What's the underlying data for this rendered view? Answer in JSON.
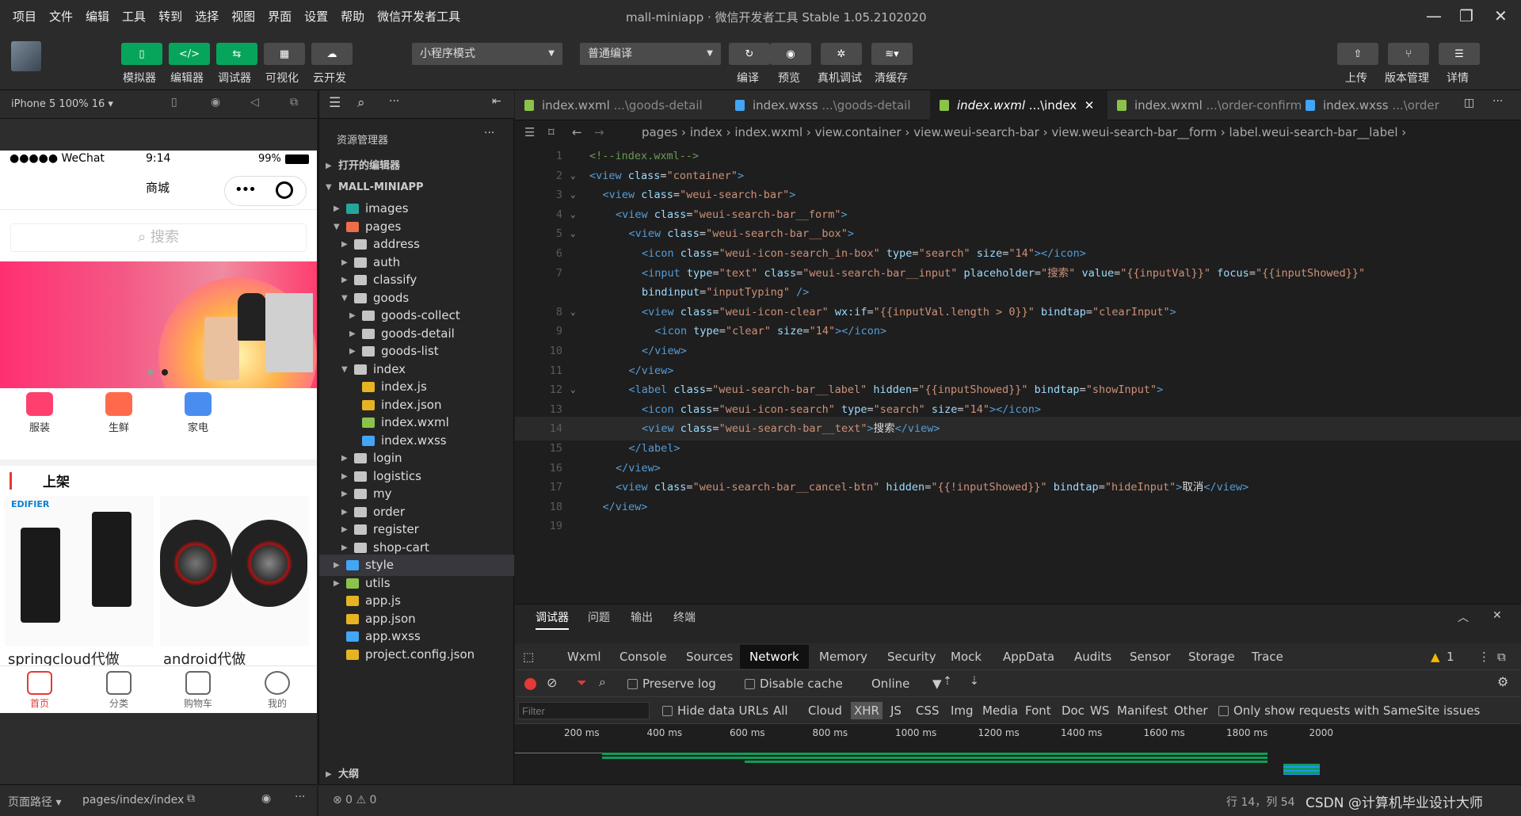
{
  "menu": [
    "项目",
    "文件",
    "编辑",
    "工具",
    "转到",
    "选择",
    "视图",
    "界面",
    "设置",
    "帮助",
    "微信开发者工具"
  ],
  "window_title": "mall-miniapp · 微信开发者工具 Stable 1.05.2102020",
  "toolbar": {
    "left_labels": [
      "模拟器",
      "编辑器",
      "调试器",
      "可视化",
      "云开发"
    ],
    "mode_dropdown": "小程序模式",
    "compile_dropdown": "普通编译",
    "mid_labels": [
      "编译",
      "预览",
      "真机调试",
      "清缓存"
    ],
    "right_labels": [
      "上传",
      "版本管理",
      "详情"
    ]
  },
  "simulator": {
    "device": "iPhone 5 100% 16 ▾",
    "carrier": "●●●●● WeChat",
    "time": "9:14",
    "battery": "99%",
    "nav_title": "商城",
    "search_placeholder": "搜索",
    "categories": [
      "服装",
      "生鲜",
      "家电"
    ],
    "section_title": "上架",
    "products": [
      "springcloud代做",
      "android代做"
    ],
    "brand1": "EDIFIER",
    "tabs": [
      "首页",
      "分类",
      "购物车",
      "我的"
    ],
    "footer_path_label": "页面路径 ▾",
    "footer_path": "pages/index/index"
  },
  "explorer": {
    "title": "资源管理器",
    "open_editors": "打开的编辑器",
    "root": "MALL-MINIAPP",
    "items": [
      {
        "name": "images",
        "depth": 1,
        "open": false,
        "kind": "folder-img"
      },
      {
        "name": "pages",
        "depth": 1,
        "open": true,
        "kind": "folder-pages"
      },
      {
        "name": "address",
        "depth": 2,
        "open": false,
        "kind": "folder"
      },
      {
        "name": "auth",
        "depth": 2,
        "open": false,
        "kind": "folder"
      },
      {
        "name": "classify",
        "depth": 2,
        "open": false,
        "kind": "folder"
      },
      {
        "name": "goods",
        "depth": 2,
        "open": true,
        "kind": "folder"
      },
      {
        "name": "goods-collect",
        "depth": 3,
        "open": false,
        "kind": "folder"
      },
      {
        "name": "goods-detail",
        "depth": 3,
        "open": false,
        "kind": "folder"
      },
      {
        "name": "goods-list",
        "depth": 3,
        "open": false,
        "kind": "folder"
      },
      {
        "name": "index",
        "depth": 2,
        "open": true,
        "kind": "folder"
      },
      {
        "name": "index.js",
        "depth": 3,
        "kind": "js"
      },
      {
        "name": "index.json",
        "depth": 3,
        "kind": "json"
      },
      {
        "name": "index.wxml",
        "depth": 3,
        "kind": "wxml"
      },
      {
        "name": "index.wxss",
        "depth": 3,
        "kind": "wxss"
      },
      {
        "name": "login",
        "depth": 2,
        "open": false,
        "kind": "folder"
      },
      {
        "name": "logistics",
        "depth": 2,
        "open": false,
        "kind": "folder"
      },
      {
        "name": "my",
        "depth": 2,
        "open": false,
        "kind": "folder"
      },
      {
        "name": "order",
        "depth": 2,
        "open": false,
        "kind": "folder"
      },
      {
        "name": "register",
        "depth": 2,
        "open": false,
        "kind": "folder"
      },
      {
        "name": "shop-cart",
        "depth": 2,
        "open": false,
        "kind": "folder"
      },
      {
        "name": "style",
        "depth": 1,
        "open": false,
        "kind": "folder-style",
        "selected": true
      },
      {
        "name": "utils",
        "depth": 1,
        "open": false,
        "kind": "folder-utils"
      },
      {
        "name": "app.js",
        "depth": 1,
        "kind": "js"
      },
      {
        "name": "app.json",
        "depth": 1,
        "kind": "json"
      },
      {
        "name": "app.wxss",
        "depth": 1,
        "kind": "wxss"
      },
      {
        "name": "project.config.json",
        "depth": 1,
        "kind": "json"
      }
    ],
    "outline": "大纲"
  },
  "editor": {
    "tabs": [
      {
        "name": "index.wxml",
        "path": "...\\goods-detail",
        "kind": "wxml"
      },
      {
        "name": "index.wxss",
        "path": "...\\goods-detail",
        "kind": "wxss"
      },
      {
        "name": "index.wxml",
        "path": "...\\index",
        "kind": "wxml",
        "active": true
      },
      {
        "name": "index.wxml",
        "path": "...\\order-confirm",
        "kind": "wxml"
      },
      {
        "name": "index.wxss",
        "path": "...\\order",
        "kind": "wxss"
      }
    ],
    "breadcrumb": "pages › index › index.wxml › view.container › view.weui-search-bar › view.weui-search-bar__form › label.weui-search-bar__label ›",
    "lines": [
      {
        "n": "1",
        "indent": 0,
        "html": "<span class=\"cm\">&lt;!--index.wxml--&gt;</span>"
      },
      {
        "n": "2",
        "indent": 0,
        "fold": true,
        "html": "<span class=\"tg\">&lt;view</span> <span class=\"at\">class</span>=<span class=\"st\">\"container\"</span><span class=\"tg\">&gt;</span>"
      },
      {
        "n": "3",
        "indent": 1,
        "fold": true,
        "html": "<span class=\"tg\">&lt;view</span> <span class=\"at\">class</span>=<span class=\"st\">\"weui-search-bar\"</span><span class=\"tg\">&gt;</span>"
      },
      {
        "n": "4",
        "indent": 2,
        "fold": true,
        "html": "<span class=\"tg\">&lt;view</span> <span class=\"at\">class</span>=<span class=\"st\">\"weui-search-bar__form\"</span><span class=\"tg\">&gt;</span>"
      },
      {
        "n": "5",
        "indent": 3,
        "fold": true,
        "html": "<span class=\"tg\">&lt;view</span> <span class=\"at\">class</span>=<span class=\"st\">\"weui-search-bar__box\"</span><span class=\"tg\">&gt;</span>"
      },
      {
        "n": "6",
        "indent": 4,
        "html": "<span class=\"tg\">&lt;icon</span> <span class=\"at\">class</span>=<span class=\"st\">\"weui-icon-search_in-box\"</span> <span class=\"at\">type</span>=<span class=\"st\">\"search\"</span> <span class=\"at\">size</span>=<span class=\"st\">\"14\"</span><span class=\"tg\">&gt;&lt;/icon&gt;</span>"
      },
      {
        "n": "7",
        "indent": 4,
        "html": "<span class=\"tg\">&lt;input</span> <span class=\"at\">type</span>=<span class=\"st\">\"text\"</span> <span class=\"at\">class</span>=<span class=\"st\">\"weui-search-bar__input\"</span> <span class=\"at\">placeholder</span>=<span class=\"st\">\"搜索\"</span> <span class=\"at\">value</span>=<span class=\"st\">\"{{inputVal}}\"</span> <span class=\"at\">focus</span>=<span class=\"st\">\"{{inputShowed}}\"</span>"
      },
      {
        "n": "",
        "indent": 4,
        "html": "<span class=\"at\">bindinput</span>=<span class=\"st\">\"inputTyping\"</span> <span class=\"tg\">/&gt;</span>"
      },
      {
        "n": "8",
        "indent": 4,
        "fold": true,
        "html": "<span class=\"tg\">&lt;view</span> <span class=\"at\">class</span>=<span class=\"st\">\"weui-icon-clear\"</span> <span class=\"at\">wx:if</span>=<span class=\"st\">\"{{inputVal.length &gt; 0}}\"</span> <span class=\"at\">bindtap</span>=<span class=\"st\">\"clearInput\"</span><span class=\"tg\">&gt;</span>"
      },
      {
        "n": "9",
        "indent": 5,
        "html": "<span class=\"tg\">&lt;icon</span> <span class=\"at\">type</span>=<span class=\"st\">\"clear\"</span> <span class=\"at\">size</span>=<span class=\"st\">\"14\"</span><span class=\"tg\">&gt;&lt;/icon&gt;</span>"
      },
      {
        "n": "10",
        "indent": 4,
        "html": "<span class=\"tg\">&lt;/view&gt;</span>"
      },
      {
        "n": "11",
        "indent": 3,
        "html": "<span class=\"tg\">&lt;/view&gt;</span>"
      },
      {
        "n": "12",
        "indent": 3,
        "fold": true,
        "html": "<span class=\"tg\">&lt;label</span> <span class=\"at\">class</span>=<span class=\"st\">\"weui-search-bar__label\"</span> <span class=\"at\">hidden</span>=<span class=\"st\">\"{{inputShowed}}\"</span> <span class=\"at\">bindtap</span>=<span class=\"st\">\"showInput\"</span><span class=\"tg\">&gt;</span>"
      },
      {
        "n": "13",
        "indent": 4,
        "html": "<span class=\"tg\">&lt;icon</span> <span class=\"at\">class</span>=<span class=\"st\">\"weui-icon-search\"</span> <span class=\"at\">type</span>=<span class=\"st\">\"search\"</span> <span class=\"at\">size</span>=<span class=\"st\">\"14\"</span><span class=\"tg\">&gt;&lt;/icon&gt;</span>"
      },
      {
        "n": "14",
        "indent": 4,
        "cur": true,
        "html": "<span class=\"tg\">&lt;view</span> <span class=\"at\">class</span>=<span class=\"st\">\"weui-search-bar__text\"</span><span class=\"tg\">&gt;</span><span class=\"tx\">搜索</span><span class=\"tg\">&lt;/view&gt;</span>"
      },
      {
        "n": "15",
        "indent": 3,
        "html": "<span class=\"tg\">&lt;/label&gt;</span>"
      },
      {
        "n": "16",
        "indent": 2,
        "html": "<span class=\"tg\">&lt;/view&gt;</span>"
      },
      {
        "n": "17",
        "indent": 2,
        "html": "<span class=\"tg\">&lt;view</span> <span class=\"at\">class</span>=<span class=\"st\">\"weui-search-bar__cancel-btn\"</span> <span class=\"at\">hidden</span>=<span class=\"st\">\"{{!inputShowed}}\"</span> <span class=\"at\">bindtap</span>=<span class=\"st\">\"hideInput\"</span><span class=\"tg\">&gt;</span><span class=\"tx\">取消</span><span class=\"tg\">&lt;/view&gt;</span>"
      },
      {
        "n": "18",
        "indent": 1,
        "html": "<span class=\"tg\">&lt;/view&gt;</span>"
      },
      {
        "n": "19",
        "indent": 0,
        "html": ""
      }
    ]
  },
  "devtools": {
    "top_tabs": [
      "调试器",
      "问题",
      "输出",
      "终端"
    ],
    "nav": [
      "Wxml",
      "Console",
      "Sources",
      "Network",
      "Memory",
      "Security",
      "Mock",
      "AppData",
      "Audits",
      "Sensor",
      "Storage",
      "Trace"
    ],
    "active_nav": "Network",
    "warn_count": "1",
    "preserve_log": "Preserve log",
    "disable_cache": "Disable cache",
    "throttle": "Online",
    "filter_placeholder": "Filter",
    "hide_data_urls": "Hide data URLs",
    "types": [
      "All",
      "Cloud",
      "XHR",
      "JS",
      "CSS",
      "Img",
      "Media",
      "Font",
      "Doc",
      "WS",
      "Manifest",
      "Other"
    ],
    "samesite": "Only show requests with SameSite issues",
    "ticks": [
      "200 ms",
      "400 ms",
      "600 ms",
      "800 ms",
      "1000 ms",
      "1200 ms",
      "1400 ms",
      "1600 ms",
      "1800 ms",
      "2000"
    ]
  },
  "status": {
    "errors": "⊗ 0 ⚠ 0",
    "position": "行 14，列 54",
    "watermark": "CSDN @计算机毕业设计大师"
  }
}
